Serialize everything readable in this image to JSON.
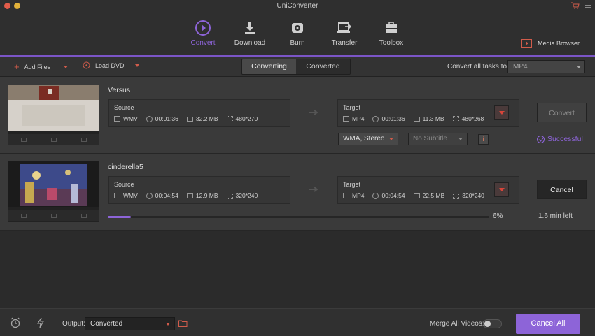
{
  "window": {
    "title": "UniConverter"
  },
  "nav": {
    "items": [
      {
        "label": "Convert",
        "icon": "convert-icon",
        "active": true
      },
      {
        "label": "Download",
        "icon": "download-icon"
      },
      {
        "label": "Burn",
        "icon": "burn-icon"
      },
      {
        "label": "Transfer",
        "icon": "transfer-icon"
      },
      {
        "label": "Toolbox",
        "icon": "toolbox-icon"
      }
    ],
    "media_browser": "Media Browser"
  },
  "toolbar": {
    "add_files": "Add Files",
    "load_dvd": "Load DVD",
    "tabs": [
      "Converting",
      "Converted"
    ],
    "convert_all_label": "Convert all tasks to:",
    "convert_all_value": "MP4"
  },
  "tasks": [
    {
      "name": "Versus",
      "source": {
        "label": "Source",
        "format": "WMV",
        "duration": "00:01:36",
        "size": "32.2 MB",
        "resolution": "480*270"
      },
      "target": {
        "label": "Target",
        "format": "MP4",
        "duration": "00:01:36",
        "size": "11.3 MB",
        "resolution": "480*268"
      },
      "audio": "WMA, Stereo",
      "subtitle": "No Subtitle",
      "info_button": "i",
      "action": "Convert",
      "status": "Successful"
    },
    {
      "name": "cinderella5",
      "source": {
        "label": "Source",
        "format": "WMV",
        "duration": "00:04:54",
        "size": "12.9 MB",
        "resolution": "320*240"
      },
      "target": {
        "label": "Target",
        "format": "MP4",
        "duration": "00:04:54",
        "size": "22.5 MB",
        "resolution": "320*240"
      },
      "progress_percent": 6,
      "progress_label": "6%",
      "time_left": "1.6 min left",
      "action": "Cancel"
    }
  ],
  "footer": {
    "output_label": "Output:",
    "output_value": "Converted",
    "merge_label": "Merge All Videos:",
    "merge_on": false,
    "cancel_all": "Cancel All"
  },
  "colors": {
    "accent": "#8d64d8",
    "caret": "#d25c4b"
  }
}
